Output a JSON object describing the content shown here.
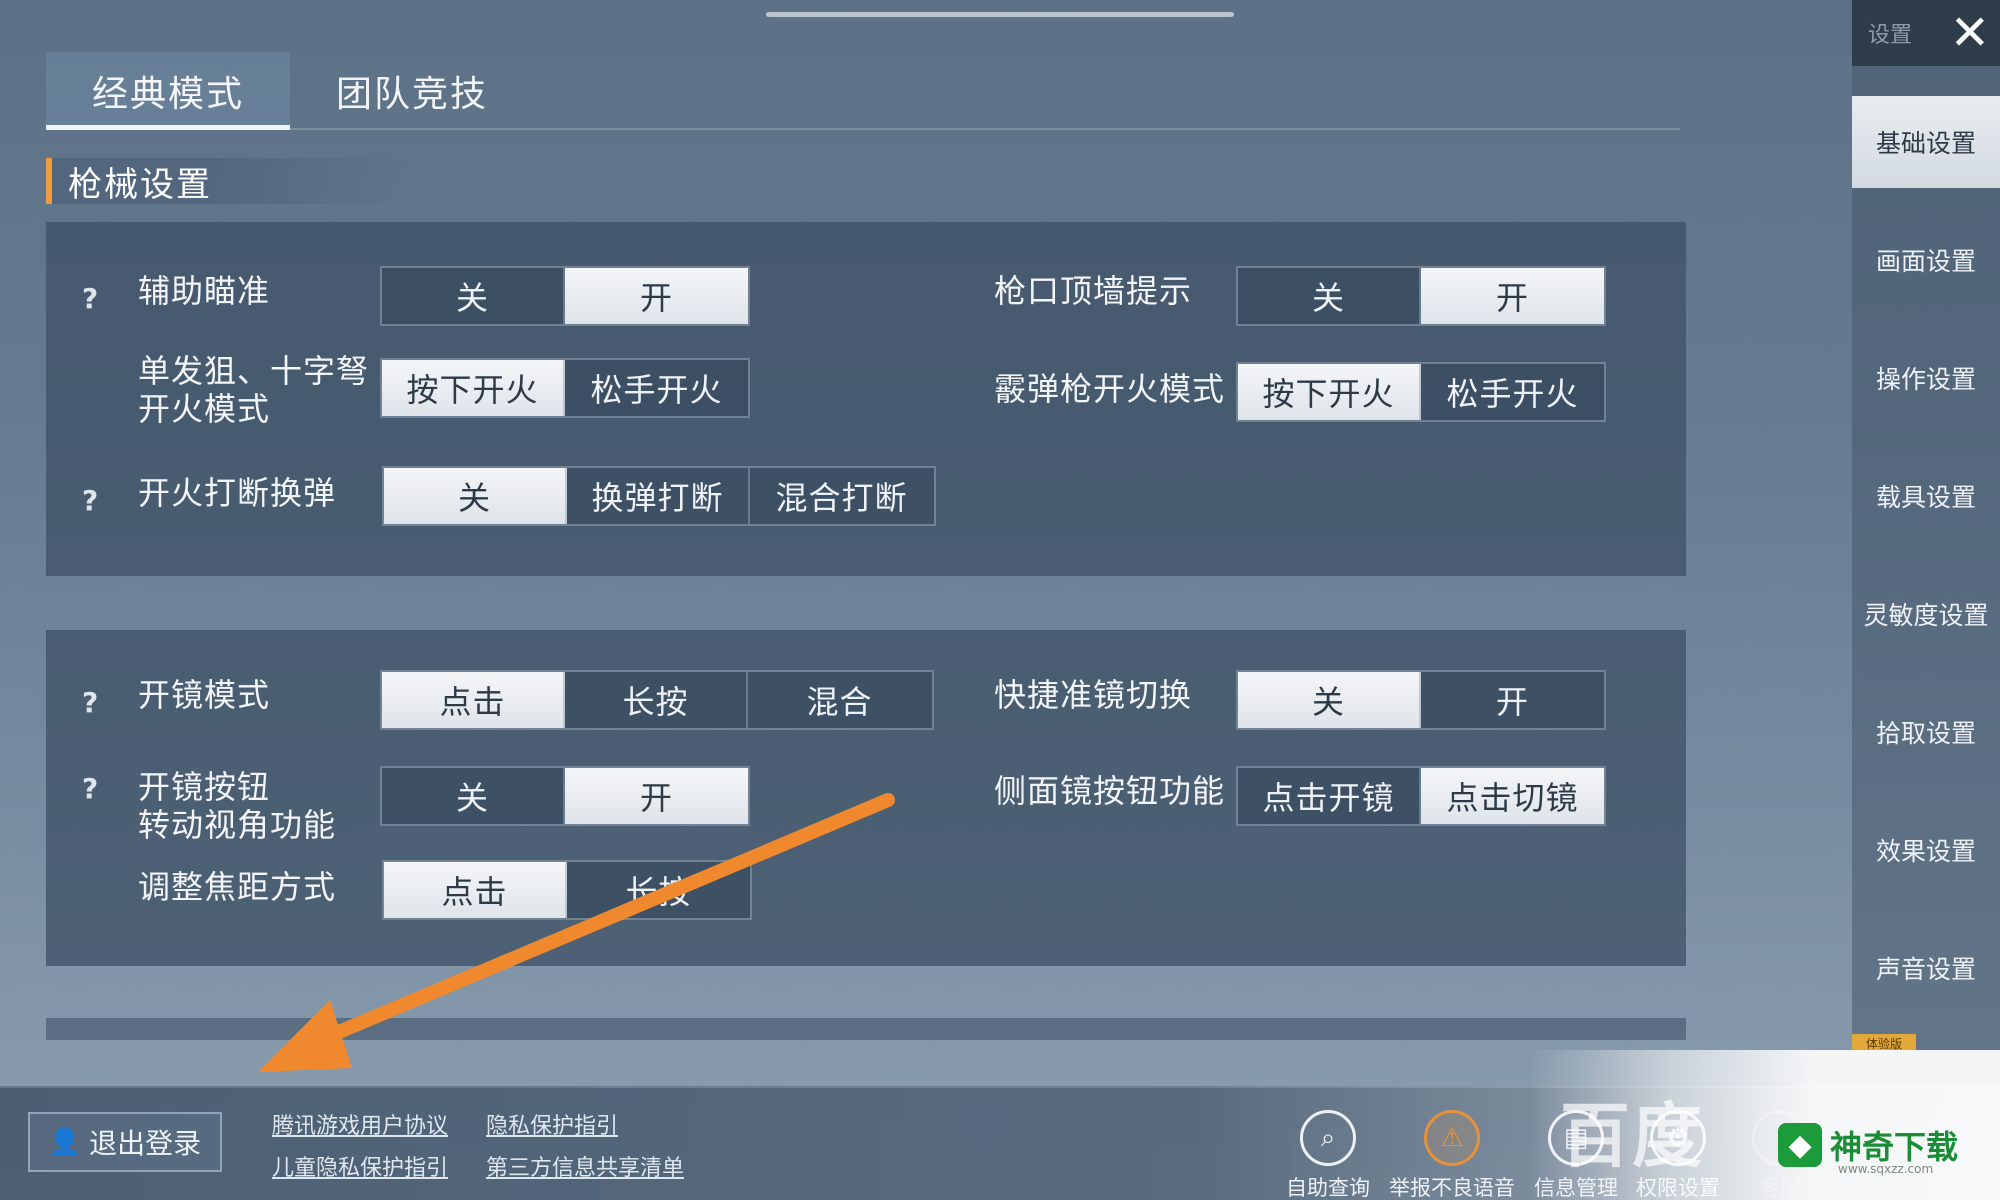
{
  "mode_tabs": [
    {
      "label": "经典模式",
      "active": true
    },
    {
      "label": "团队竞技",
      "active": false
    }
  ],
  "section_title": "枪械设置",
  "panel1": {
    "aim_assist": {
      "label": "辅助瞄准",
      "options": [
        "关",
        "开"
      ],
      "selected": "开"
    },
    "muzzle_wall": {
      "label": "枪口顶墙提示",
      "options": [
        "关",
        "开"
      ],
      "selected": "开"
    },
    "single_shot": {
      "label_line1": "单发狙、十字弩",
      "label_line2": "开火模式",
      "options": [
        "按下开火",
        "松手开火"
      ],
      "selected": "按下开火"
    },
    "shotgun_mode": {
      "label": "霰弹枪开火模式",
      "options": [
        "按下开火",
        "松手开火"
      ],
      "selected": "按下开火"
    },
    "fire_interrupt": {
      "label": "开火打断换弹",
      "options": [
        "关",
        "换弹打断",
        "混合打断"
      ],
      "selected": "关"
    }
  },
  "panel2": {
    "scope_mode": {
      "label": "开镜模式",
      "options": [
        "点击",
        "长按",
        "混合"
      ],
      "selected": "点击"
    },
    "quick_scope": {
      "label": "快捷准镜切换",
      "options": [
        "关",
        "开"
      ],
      "selected": "关"
    },
    "scope_button": {
      "label_line1": "开镜按钮",
      "label_line2": "转动视角功能",
      "options": [
        "关",
        "开"
      ],
      "selected": "开"
    },
    "side_scope": {
      "label": "侧面镜按钮功能",
      "options": [
        "点击开镜",
        "点击切镜"
      ],
      "selected": "点击切镜"
    },
    "focus_adjust": {
      "label": "调整焦距方式",
      "options": [
        "点击",
        "长按"
      ],
      "selected": "点击"
    }
  },
  "help_symbol": "?",
  "sidebar": {
    "header_label": "设置",
    "close_icon": "close-icon",
    "items": [
      "基础设置",
      "画面设置",
      "操作设置",
      "载具设置",
      "灵敏度设置",
      "拾取设置",
      "效果设置",
      "声音设置"
    ],
    "active_index": 0,
    "badge": "体验版"
  },
  "bottom": {
    "logout_label": "退出登录",
    "links": [
      "腾讯游戏用户协议",
      "隐私保护指引",
      "儿童隐私保护指引",
      "第三方信息共享清单"
    ],
    "icons": [
      {
        "label": "自助查询",
        "icon": "search-icon",
        "glyph": "🔍"
      },
      {
        "label": "举报不良语音",
        "icon": "warning-icon",
        "glyph": "⚠"
      },
      {
        "label": "信息管理",
        "icon": "document-icon",
        "glyph": "▤"
      },
      {
        "label": "权限设置",
        "icon": "settings-icon",
        "glyph": "⚙"
      },
      {
        "label": "客服",
        "icon": "support-icon",
        "glyph": ""
      }
    ]
  },
  "watermarks": {
    "baidu": "百度",
    "sq_brand": "神奇下载",
    "sq_url": "www.sqxzz.com"
  },
  "colors": {
    "accent": "#f39b3a",
    "selected_bg": "#eef1f4",
    "panel_bg": "#3f5267"
  }
}
